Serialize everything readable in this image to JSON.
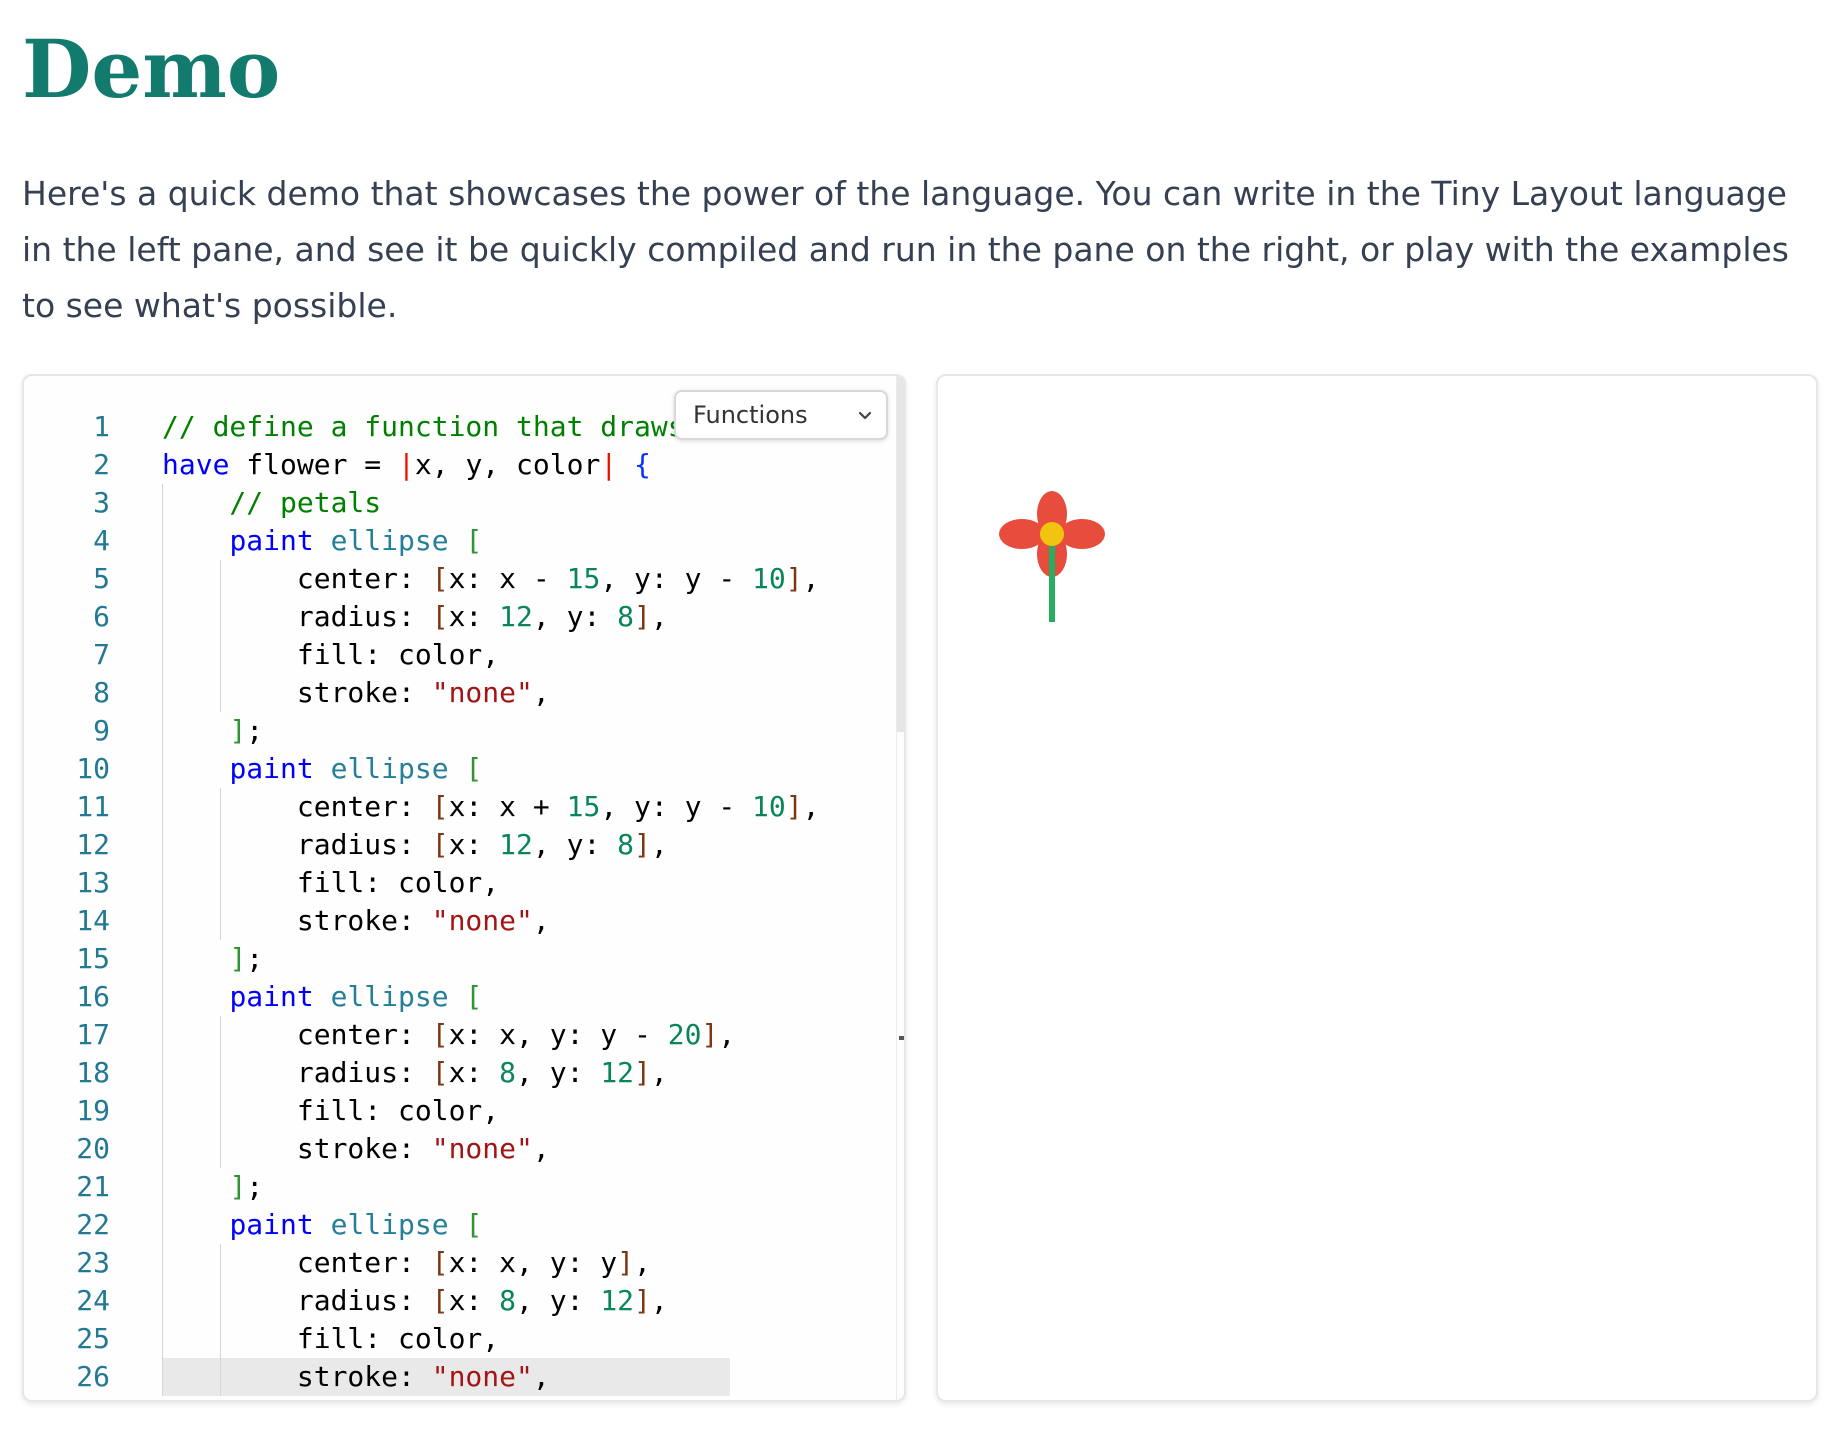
{
  "page": {
    "title": "Demo",
    "intro": "Here's a quick demo that showcases the power of the language. You can write in the Tiny Layout language in the left pane, and see it be quickly compiled and run in the pane on the right, or play with the examples to see what's possible."
  },
  "examples_dropdown": {
    "selected": "Functions",
    "icon": "chevron-down-icon"
  },
  "editor": {
    "line_numbers": [
      "1",
      "2",
      "3",
      "4",
      "5",
      "6",
      "7",
      "8",
      "9",
      "10",
      "11",
      "12",
      "13",
      "14",
      "15",
      "16",
      "17",
      "18",
      "19",
      "20",
      "21",
      "22",
      "23",
      "24",
      "25",
      "26"
    ],
    "code_lines": [
      "// define a function that draws",
      "have flower = |x, y, color| {",
      "    // petals",
      "    paint ellipse [",
      "        center: [x: x - 15, y: y - 10],",
      "        radius: [x: 12, y: 8],",
      "        fill: color,",
      "        stroke: \"none\",",
      "    ];",
      "    paint ellipse [",
      "        center: [x: x + 15, y: y - 10],",
      "        radius: [x: 12, y: 8],",
      "        fill: color,",
      "        stroke: \"none\",",
      "    ];",
      "    paint ellipse [",
      "        center: [x: x, y: y - 20],",
      "        radius: [x: 8, y: 12],",
      "        fill: color,",
      "        stroke: \"none\",",
      "    ];",
      "    paint ellipse [",
      "        center: [x: x, y: y],",
      "        radius: [x: 8, y: 12],",
      "        fill: color,",
      "        stroke: \"none\","
    ]
  },
  "colors": {
    "title": "#137a6e",
    "petal": "#e74c3c",
    "flower_center": "#f1c40f",
    "stem": "#27ae60"
  }
}
